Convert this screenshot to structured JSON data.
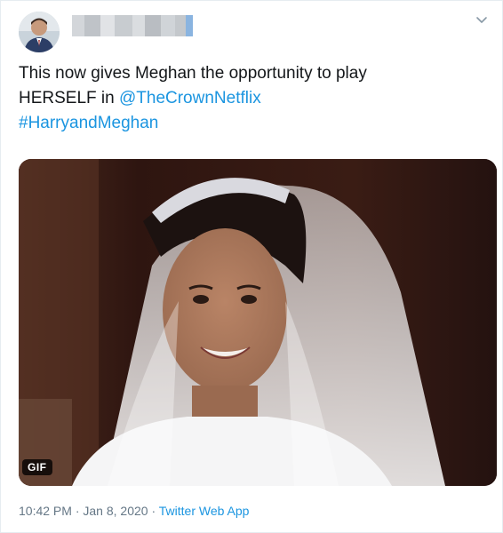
{
  "tweet": {
    "text_line1": "This now gives Meghan the opportunity to play",
    "text_line2_prefix": "HERSELF in ",
    "mention": "@TheCrownNetflix",
    "hashtag": "#HarryandMeghan",
    "media": {
      "badge": "GIF",
      "icon": "bride-gif-image"
    },
    "time": "10:42 PM",
    "separator": "·",
    "date": "Jan 8, 2020",
    "source": "Twitter Web App"
  },
  "colors": {
    "link": "#1b95e0",
    "meta": "#657786",
    "text": "#14171a"
  }
}
